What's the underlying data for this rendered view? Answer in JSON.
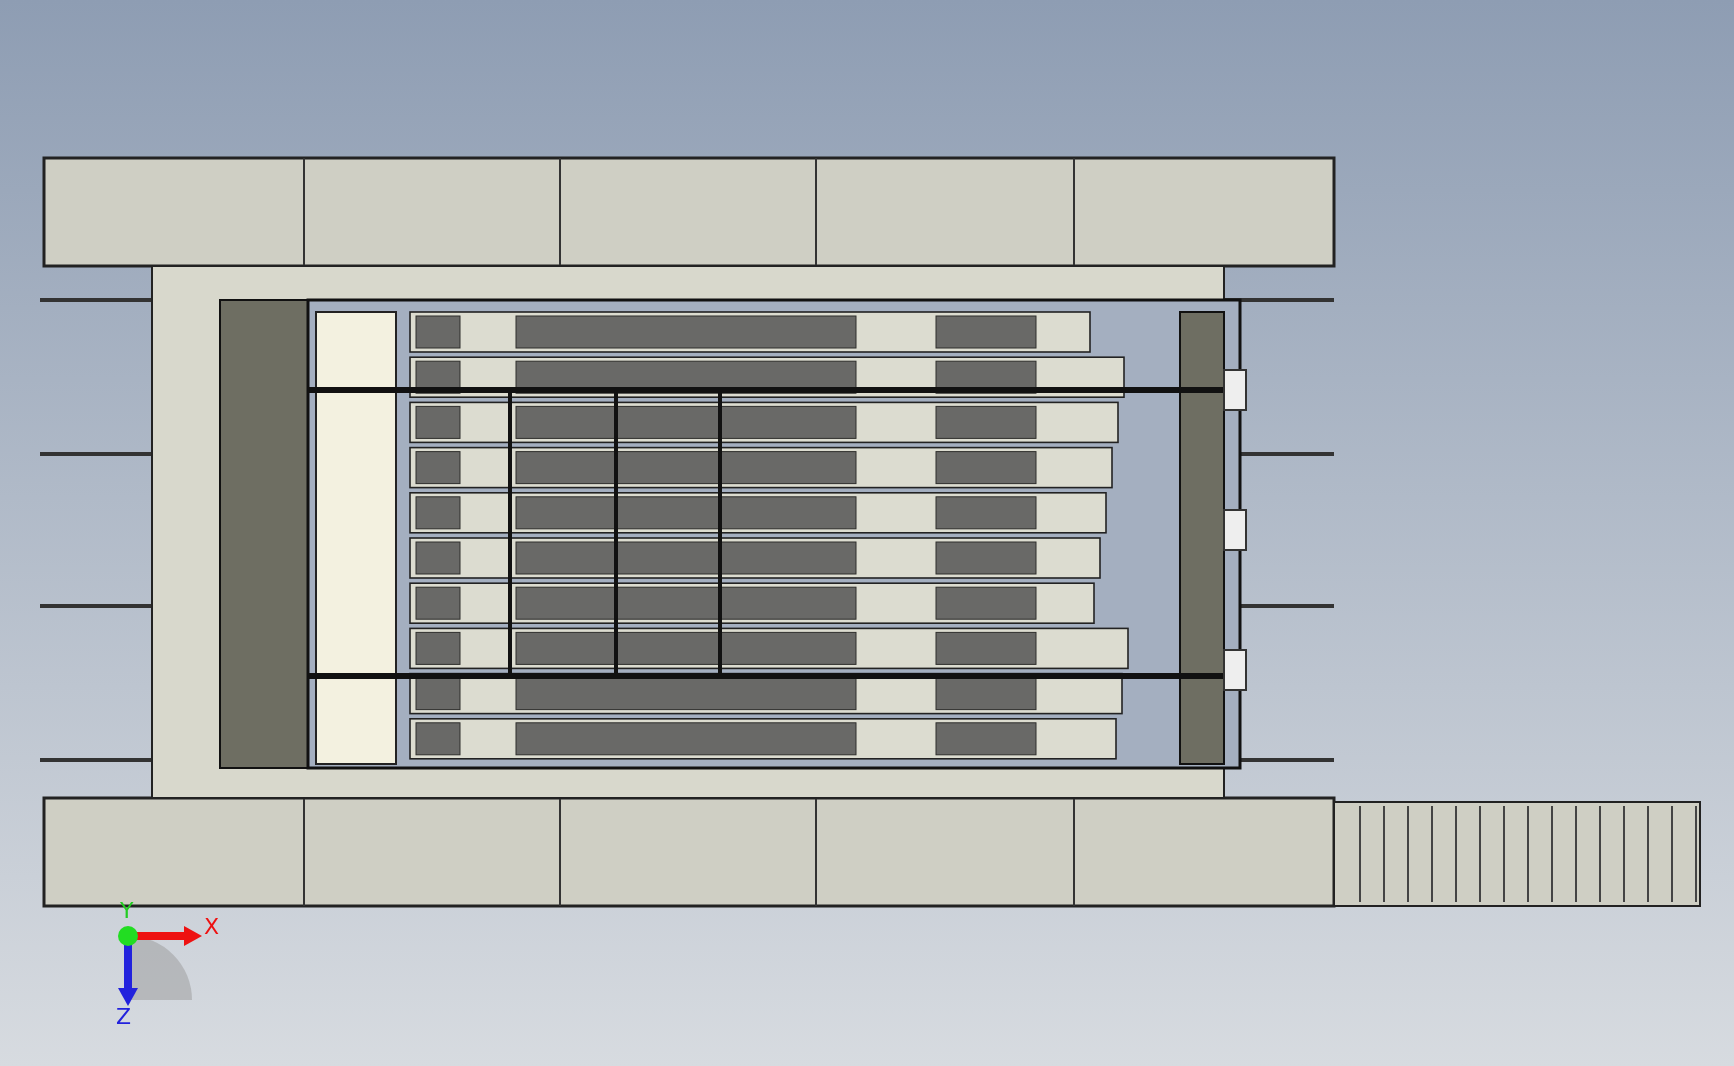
{
  "viewport": {
    "triad": [
      {
        "kind": "y",
        "label": "Y"
      },
      {
        "kind": "x",
        "label": "X"
      },
      {
        "kind": "z",
        "label": "Z"
      }
    ]
  }
}
